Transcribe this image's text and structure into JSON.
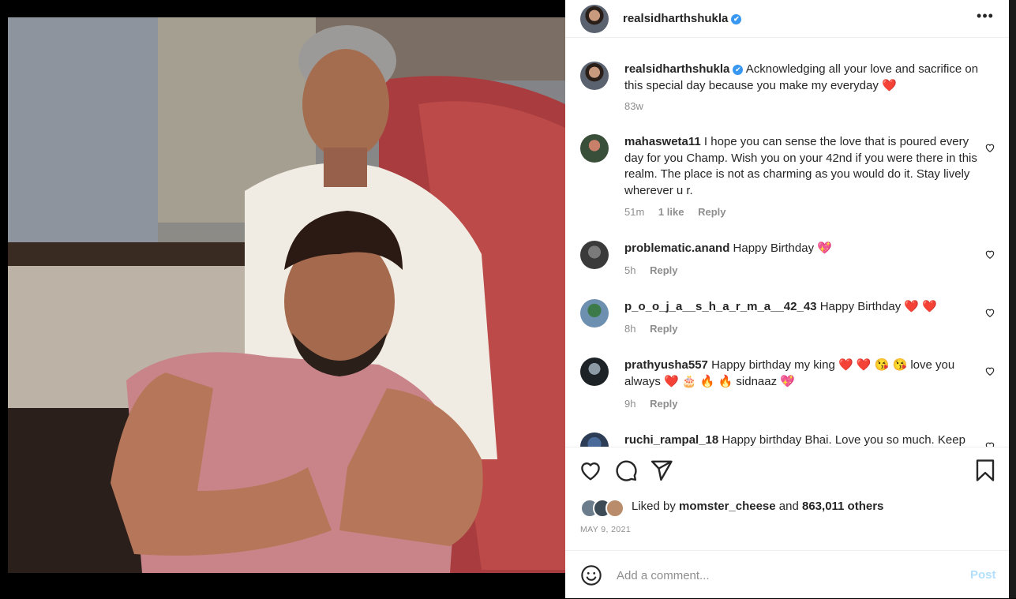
{
  "post": {
    "username": "realsidharthshukla",
    "verified_glyph": "✔",
    "more_glyph": "•••",
    "caption": "Acknowledging all your love and sacrifice on this special day because you make my everyday ❤️",
    "caption_time": "83w"
  },
  "comments": [
    {
      "user": "mahasweta11",
      "text": "I hope you can sense the love that is poured every day for you Champ. Wish you on your 42nd if you were there in this realm. The place is not as charming as you would do it. Stay lively wherever u r.",
      "time": "51m",
      "likes": "1 like",
      "reply": "Reply"
    },
    {
      "user": "problematic.anand",
      "text": "Happy Birthday 💖",
      "time": "5h",
      "reply": "Reply"
    },
    {
      "user": "p_o_o_j_a__s_h_a_r_m_a__42_43",
      "text": "Happy Birthday ❤️ ❤️",
      "time": "8h",
      "reply": "Reply"
    },
    {
      "user": "prathyusha557",
      "text": "Happy birthday my king ❤️ ❤️ 😘 😘 love you always ❤️ 🎂 🔥 🔥 sidnaaz 💖",
      "time": "9h",
      "reply": "Reply"
    },
    {
      "user": "ruchi_rampal_18",
      "text": "Happy birthday Bhai. Love you so much. Keep"
    }
  ],
  "likes": {
    "prefix": "Liked by",
    "user": "momster_cheese",
    "and": "and",
    "count": "863,011 others"
  },
  "date": "MAY 9, 2021",
  "add_comment": {
    "placeholder": "Add a comment...",
    "post_label": "Post"
  },
  "colors": {
    "accent": "#0095f6",
    "post_disabled": "#b2dffc",
    "heart": "#e0245e",
    "verified": "#3897f0"
  }
}
